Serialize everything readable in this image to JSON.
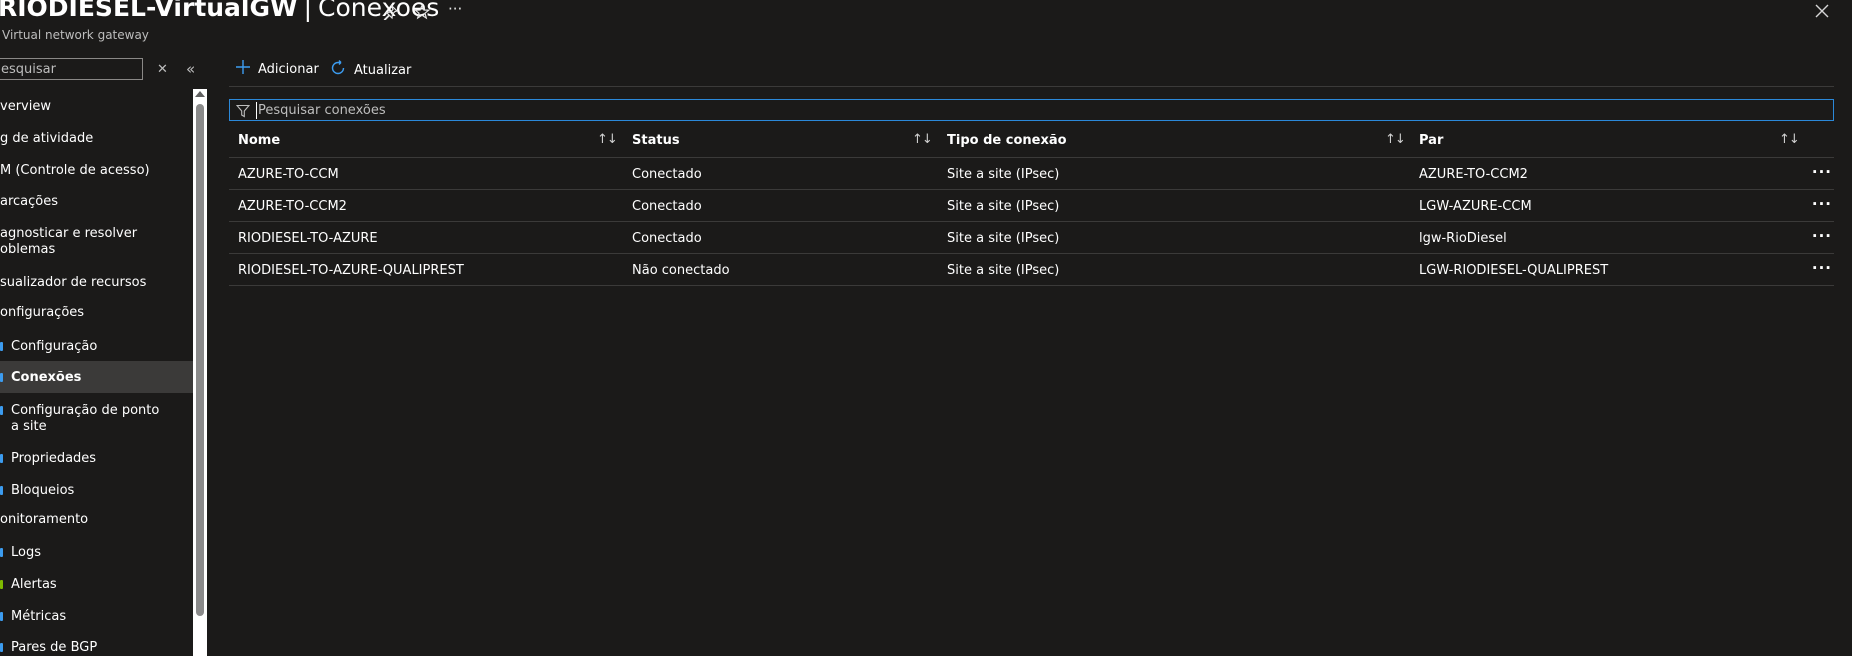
{
  "header": {
    "resource_name": "RIODIESEL-VirtualGW",
    "separator": "|",
    "page_name": "Conexões",
    "subtitle": "Virtual network gateway",
    "icons": {
      "pin": "pin-icon",
      "favorite": "star-icon",
      "more": "ellipsis-icon",
      "close": "close-icon"
    }
  },
  "nav": {
    "search_placeholder": "esquisar",
    "items": [
      {
        "label": "verview",
        "sub": false
      },
      {
        "label": "g de atividade",
        "sub": false
      },
      {
        "label": "M (Controle de acesso)",
        "sub": false
      },
      {
        "label": "arcações",
        "sub": false
      },
      {
        "label": "agnosticar e resolver",
        "label2": "oblemas",
        "sub": false
      },
      {
        "label": "sualizador de recursos",
        "sub": false
      },
      {
        "label": "onfigurações",
        "sub": false
      },
      {
        "label": "Configuração",
        "sub": true,
        "dot": "#3c9cf0"
      },
      {
        "label": "Conexões",
        "sub": true,
        "dot": "#3c9cf0",
        "selected": true
      },
      {
        "label": "Configuração de ponto",
        "label2": "a site",
        "sub": true,
        "dot": "#3c9cf0"
      },
      {
        "label": "Propriedades",
        "sub": true,
        "dot": "#3c9cf0"
      },
      {
        "label": "Bloqueios",
        "sub": true,
        "dot": "#3c9cf0"
      },
      {
        "label": "onitoramento",
        "sub": false
      },
      {
        "label": "Logs",
        "sub": true,
        "dot": "#3c9cf0"
      },
      {
        "label": "Alertas",
        "sub": true,
        "dot": "#7fba00"
      },
      {
        "label": "Métricas",
        "sub": true,
        "dot": "#3c9cf0"
      },
      {
        "label": "Pares de BGP",
        "sub": true,
        "dot": "#3c9cf0"
      }
    ]
  },
  "toolbar": {
    "add_label": "Adicionar",
    "refresh_label": "Atualizar"
  },
  "filter": {
    "placeholder": "Pesquisar conexões"
  },
  "table": {
    "columns": [
      "Nome",
      "Status",
      "Tipo de conexão",
      "Par"
    ],
    "rows": [
      [
        "AZURE-TO-CCM",
        "Conectado",
        "Site a site (IPsec)",
        "AZURE-TO-CCM2"
      ],
      [
        "AZURE-TO-CCM2",
        "Conectado",
        "Site a site (IPsec)",
        "LGW-AZURE-CCM"
      ],
      [
        "RIODIESEL-TO-AZURE",
        "Conectado",
        "Site a site (IPsec)",
        "lgw-RioDiesel"
      ],
      [
        "RIODIESEL-TO-AZURE-QUALIPREST",
        "Não conectado",
        "Site a site (IPsec)",
        "LGW-RIODIESEL-QUALIPREST"
      ]
    ],
    "row_more": "···"
  },
  "colors": {
    "accent": "#3c9cf0",
    "background": "#1b1a19",
    "selected": "#3b3a39"
  }
}
